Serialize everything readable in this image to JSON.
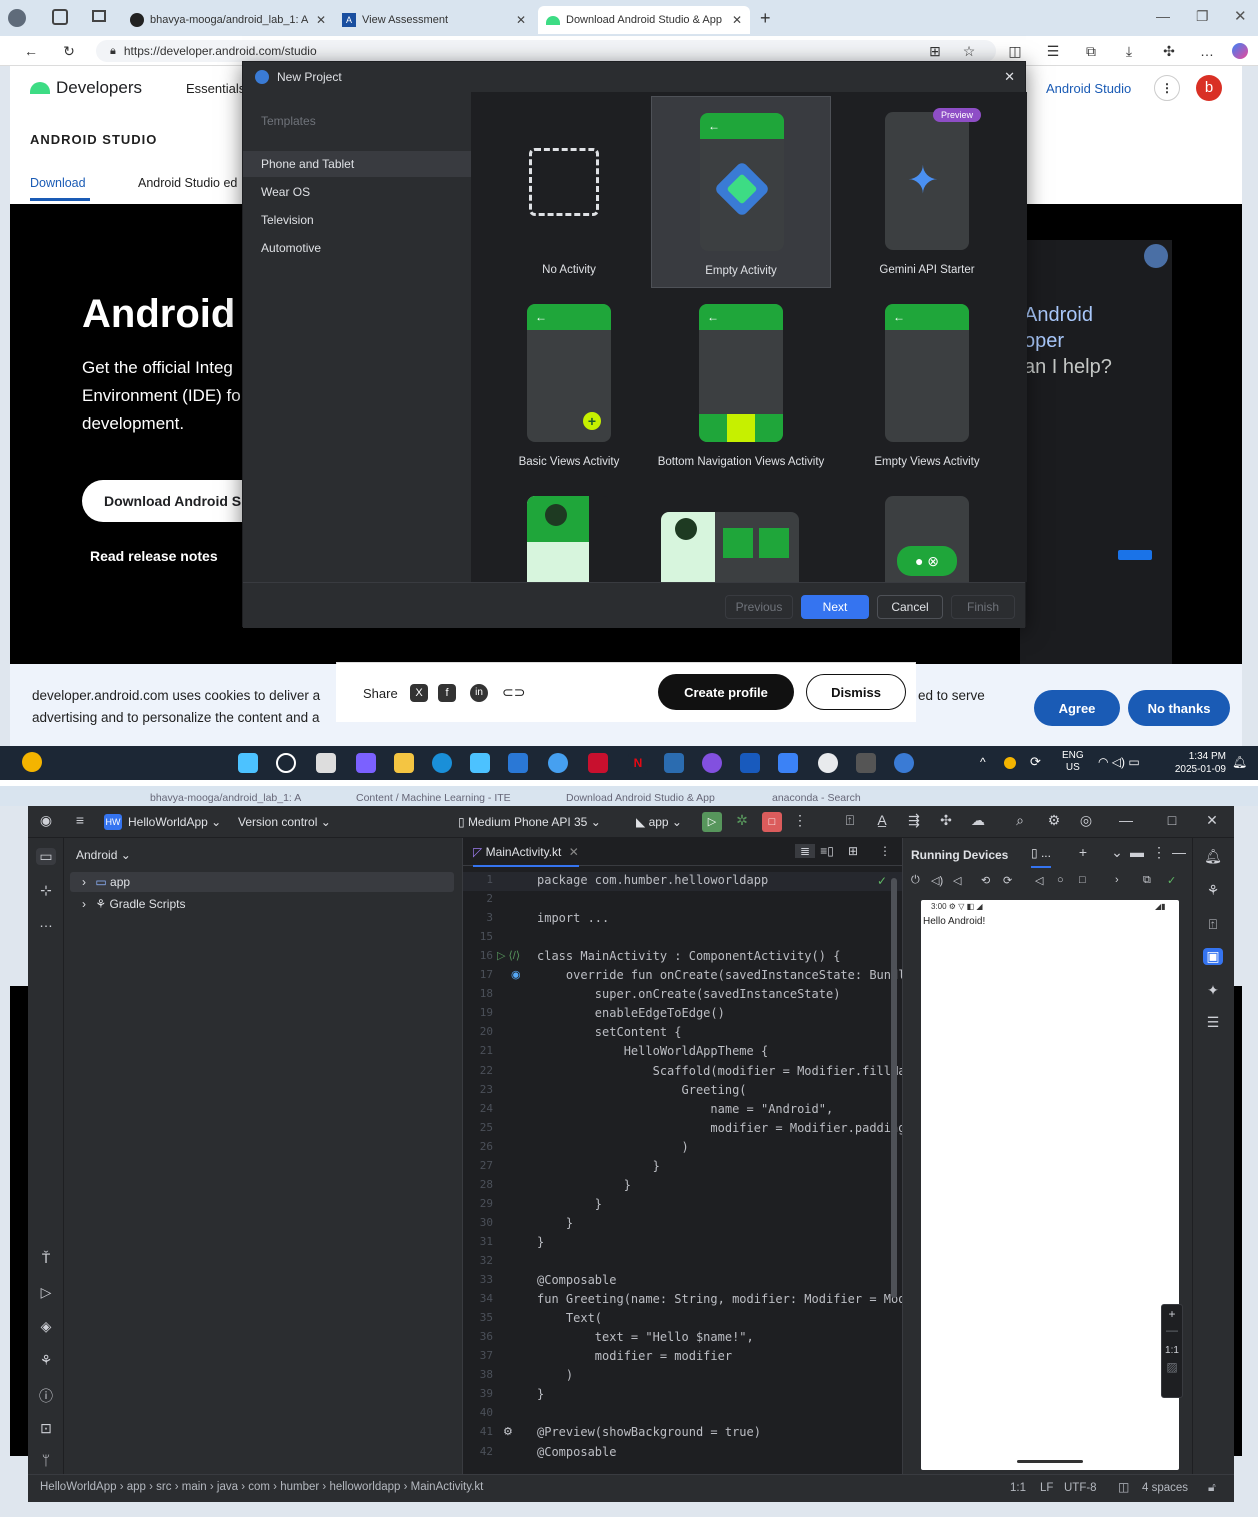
{
  "browser": {
    "tabs": [
      {
        "label": "bhavya-mooga/android_lab_1: A"
      },
      {
        "label": "View Assessment"
      },
      {
        "label": "Download Android Studio & App"
      }
    ],
    "url": "https://developer.android.com/studio",
    "site": {
      "logo": "Developers",
      "nav_essentials": "Essentials",
      "nav_android_studio": "Android Studio",
      "avatar": "b",
      "section": "ANDROID STUDIO",
      "subnav_download": "Download",
      "subnav_second": "Android Studio ed",
      "hero_title": "Android",
      "hero_text": "Get the official Integ Environment (IDE) fo development.",
      "download_button": "Download Android S",
      "release_notes": "Read release notes",
      "gemini_lines": [
        "Android",
        "oper",
        "an I help?"
      ],
      "cookie_text_1": "developer.android.com uses cookies to deliver a",
      "cookie_text_2": "advertising and to personalize the content and a",
      "cookie_text_end": "ed to serve",
      "agree": "Agree",
      "no_thanks": "No thanks",
      "share": "Share",
      "create_profile": "Create profile",
      "dismiss": "Dismiss"
    }
  },
  "dialog": {
    "title": "New Project",
    "templates_header": "Templates",
    "categories": [
      "Phone and Tablet",
      "Wear OS",
      "Television",
      "Automotive"
    ],
    "selected_category": "Phone and Tablet",
    "templates": [
      {
        "name": "No Activity"
      },
      {
        "name": "Empty Activity"
      },
      {
        "name": "Gemini API Starter",
        "badge": "Preview"
      },
      {
        "name": "Basic Views Activity"
      },
      {
        "name": "Bottom Navigation Views Activity"
      },
      {
        "name": "Empty Views Activity"
      }
    ],
    "selected_template": "Empty Activity",
    "buttons": {
      "previous": "Previous",
      "next": "Next",
      "cancel": "Cancel",
      "finish": "Finish"
    }
  },
  "taskbar": {
    "lang": "ENG",
    "region": "US",
    "time": "1:34 PM",
    "date": "2025-01-09"
  },
  "browser2": {
    "tabs": [
      {
        "label": "bhavya-mooga/android_lab_1: A"
      },
      {
        "label": "Content / Machine Learning - ITE"
      },
      {
        "label": "Download Android Studio & App"
      },
      {
        "label": "anaconda - Search"
      }
    ]
  },
  "ide": {
    "project_badge": "HW",
    "project_name": "HelloWorldApp",
    "version_control": "Version control",
    "device": "Medium Phone API 35",
    "run_config": "app",
    "project_view": "Android",
    "tree": [
      {
        "label": "app"
      },
      {
        "label": "Gradle Scripts"
      }
    ],
    "editor_tab": "MainActivity.kt",
    "running_devices_title": "Running Devices",
    "device_tab": "...",
    "device_screen": {
      "status_time": "3:00",
      "text": "Hello Android!"
    },
    "zoom_ratio": "1:1",
    "breadcrumbs": [
      "HelloWorldApp",
      "app",
      "src",
      "main",
      "java",
      "com",
      "humber",
      "helloworldapp",
      "MainActivity.kt"
    ],
    "status": {
      "position": "1:1",
      "line_sep": "LF",
      "encoding": "UTF-8",
      "indent": "4 spaces"
    },
    "code_lines": [
      {
        "n": "1",
        "text": "package com.humber.helloworldapp"
      },
      {
        "n": "2",
        "text": ""
      },
      {
        "n": "3",
        "text": "import ..."
      },
      {
        "n": "15",
        "text": ""
      },
      {
        "n": "16",
        "text": "class MainActivity : ComponentActivity() {"
      },
      {
        "n": "17",
        "text": "    override fun onCreate(savedInstanceState: Bundle"
      },
      {
        "n": "18",
        "text": "        super.onCreate(savedInstanceState)"
      },
      {
        "n": "19",
        "text": "        enableEdgeToEdge()"
      },
      {
        "n": "20",
        "text": "        setContent {"
      },
      {
        "n": "21",
        "text": "            HelloWorldAppTheme {"
      },
      {
        "n": "22",
        "text": "                Scaffold(modifier = Modifier.fillMax"
      },
      {
        "n": "23",
        "text": "                    Greeting("
      },
      {
        "n": "24",
        "text": "                        name = \"Android\","
      },
      {
        "n": "25",
        "text": "                        modifier = Modifier.padding("
      },
      {
        "n": "26",
        "text": "                    )"
      },
      {
        "n": "27",
        "text": "                }"
      },
      {
        "n": "28",
        "text": "            }"
      },
      {
        "n": "29",
        "text": "        }"
      },
      {
        "n": "30",
        "text": "    }"
      },
      {
        "n": "31",
        "text": "}"
      },
      {
        "n": "32",
        "text": ""
      },
      {
        "n": "33",
        "text": "@Composable"
      },
      {
        "n": "34",
        "text": "fun Greeting(name: String, modifier: Modifier = Modi"
      },
      {
        "n": "35",
        "text": "    Text("
      },
      {
        "n": "36",
        "text": "        text = \"Hello $name!\","
      },
      {
        "n": "37",
        "text": "        modifier = modifier"
      },
      {
        "n": "38",
        "text": "    )"
      },
      {
        "n": "39",
        "text": "}"
      },
      {
        "n": "40",
        "text": ""
      },
      {
        "n": "41",
        "text": "@Preview(showBackground = true)"
      },
      {
        "n": "42",
        "text": "@Composable"
      }
    ]
  },
  "colors": {
    "android_green": "#1fa63a",
    "accent_blue": "#3574f0",
    "ide_bg": "#1e1f22",
    "panel_bg": "#2b2d30"
  }
}
